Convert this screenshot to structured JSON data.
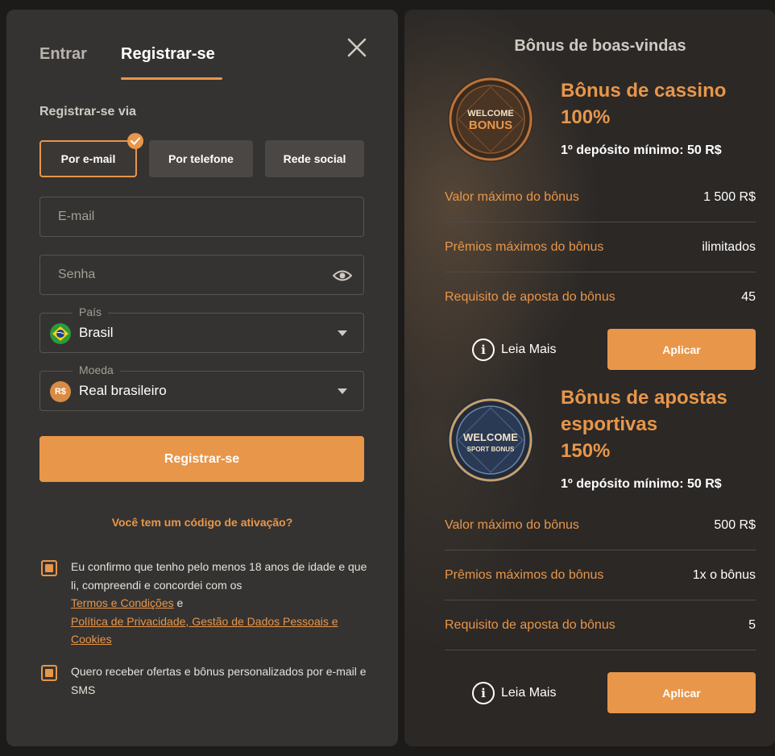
{
  "auth_tabs": {
    "login": "Entrar",
    "register": "Registrar-se"
  },
  "register_via": {
    "label": "Registrar-se via",
    "methods": [
      {
        "label": "Por e-mail",
        "selected": true
      },
      {
        "label": "Por telefone",
        "selected": false
      },
      {
        "label": "Rede social",
        "selected": false
      }
    ]
  },
  "form": {
    "email_placeholder": "E-mail",
    "password_placeholder": "Senha",
    "country": {
      "legend": "País",
      "value": "Brasil"
    },
    "currency": {
      "legend": "Moeda",
      "value": "Real brasileiro",
      "badge": "R$"
    },
    "submit_label": "Registrar-se",
    "activation_link": "Você tem um código de ativação?"
  },
  "consent": {
    "age_text": "Eu confirmo que tenho pelo menos 18 anos de idade e que li, compreendi e concordei com os",
    "terms_link": "Termos e Condições",
    "and": "e",
    "privacy_link": "Política de Privacidade, Gestão de Dados Pessoais e Cookies",
    "offers_text": "Quero receber ofertas e bônus personalizados por e-mail e SMS"
  },
  "welcome": {
    "title": "Bônus de boas-vindas",
    "casino": {
      "medal_line1": "WELCOME",
      "medal_line2": "BONUS",
      "heading_line1": "Bônus de cassino",
      "heading_line2": "100%",
      "min_deposit": "1º depósito mínimo: 50 R$",
      "rows": [
        {
          "key": "Valor máximo do bônus",
          "value": "1 500 R$"
        },
        {
          "key": "Prêmios máximos do bônus",
          "value": "ilimitados"
        },
        {
          "key": "Requisito de aposta do bônus",
          "value": "45"
        }
      ],
      "more_label": "Leia Mais",
      "apply_label": "Aplicar"
    },
    "sport": {
      "medal_line1": "WELCOME",
      "medal_line2": "SPORT BONUS",
      "heading_line1": "Bônus de apostas",
      "heading_line2": "esportivas",
      "heading_line3": "150%",
      "min_deposit": "1º depósito mínimo: 50 R$",
      "rows": [
        {
          "key": "Valor máximo do bônus",
          "value": "500 R$"
        },
        {
          "key": "Prêmios máximos do bônus",
          "value": "1x o bônus"
        },
        {
          "key": "Requisito de aposta do bônus",
          "value": "5"
        }
      ],
      "more_label": "Leia Mais",
      "apply_label": "Aplicar"
    }
  },
  "colors": {
    "accent": "#e8964a",
    "panel": "#353331",
    "background": "#1c1b1a"
  }
}
